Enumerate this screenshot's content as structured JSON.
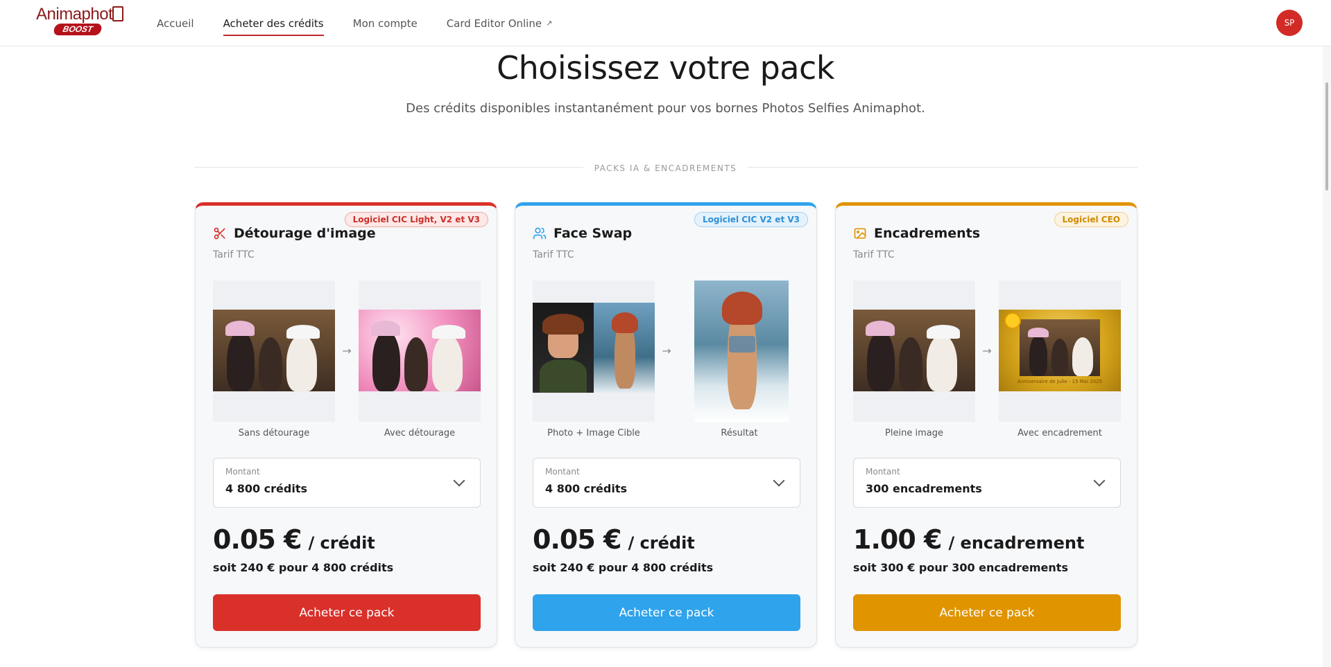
{
  "header": {
    "logo_text": "Animaphot",
    "logo_badge": "BOOST",
    "nav": [
      {
        "label": "Accueil",
        "active": false
      },
      {
        "label": "Acheter des crédits",
        "active": true
      },
      {
        "label": "Mon compte",
        "active": false
      },
      {
        "label": "Card Editor Online",
        "active": false,
        "external": true
      }
    ],
    "external_icon": "↗",
    "avatar_initials": "SP"
  },
  "page": {
    "title": "Choisissez votre pack",
    "subtitle": "Des crédits disponibles instantanément pour vos bornes Photos Selfies Animaphot.",
    "section_label": "PACKS IA & ENCADREMENTS"
  },
  "cards": [
    {
      "title": "Détourage d'image",
      "icon": "scissors-icon",
      "badge": "Logiciel CIC Light, V2 et V3",
      "tarif": "Tarif TTC",
      "before_caption": "Sans détourage",
      "after_caption": "Avec détourage",
      "amount_label": "Montant",
      "amount_value": "4 800 crédits",
      "price": "0.05 €",
      "price_unit": "/ crédit",
      "total": "soit 240 € pour 4 800 crédits",
      "button": "Acheter ce pack",
      "accent": "#d9302a",
      "badge_bg": "#fde8e7",
      "badge_color": "#c9302a"
    },
    {
      "title": "Face Swap",
      "icon": "users-icon",
      "badge": "Logiciel CIC V2 et V3",
      "tarif": "Tarif TTC",
      "before_caption": "Photo + Image Cible",
      "after_caption": "Résultat",
      "amount_label": "Montant",
      "amount_value": "4 800 crédits",
      "price": "0.05 €",
      "price_unit": "/ crédit",
      "total": "soit 240 € pour 4 800 crédits",
      "button": "Acheter ce pack",
      "accent": "#2fa3ec",
      "badge_bg": "#e3f2fd",
      "badge_color": "#2f8fd6"
    },
    {
      "title": "Encadrements",
      "icon": "image-icon",
      "badge": "Logiciel CEO",
      "tarif": "Tarif TTC",
      "before_caption": "Pleine image",
      "after_caption": "Avec encadrement",
      "amount_label": "Montant",
      "amount_value": "300 encadrements",
      "price": "1.00 €",
      "price_unit": "/ encadrement",
      "total": "soit 300 € pour 300 encadrements",
      "button": "Acheter ce pack",
      "accent": "#e09400",
      "badge_bg": "#fdf3e0",
      "badge_color": "#d08a00",
      "frame_caption": "Anniversaire de Julie - 15 Mai 2025"
    }
  ]
}
